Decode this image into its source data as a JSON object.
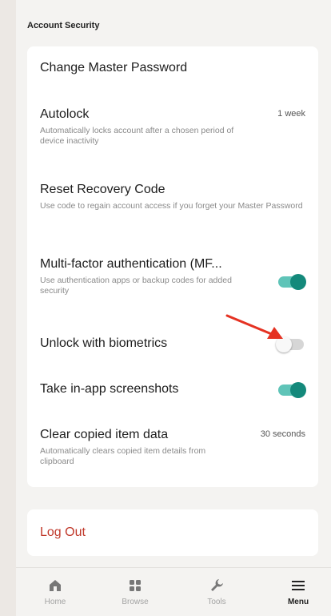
{
  "section_title": "Account Security",
  "settings": [
    {
      "title": "Change Master Password"
    },
    {
      "title": "Autolock",
      "value": "1 week",
      "subtitle": "Automatically locks account after a chosen period of device inactivity"
    },
    {
      "title": "Reset Recovery Code",
      "subtitle": "Use code to regain account access if you forget your Master Password"
    },
    {
      "title": "Multi-factor authentication (MF...",
      "subtitle": "Use authentication apps or backup codes for added security",
      "toggle_on": true
    },
    {
      "title": "Unlock with biometrics",
      "toggle_on": false
    },
    {
      "title": "Take in-app screenshots",
      "toggle_on": true
    },
    {
      "title": "Clear copied item data",
      "value": "30 seconds",
      "subtitle": "Automatically clears copied item details from clipboard"
    }
  ],
  "logout_label": "Log Out",
  "tabs": [
    {
      "label": "Home",
      "icon": "home-icon"
    },
    {
      "label": "Browse",
      "icon": "grid-icon"
    },
    {
      "label": "Tools",
      "icon": "wrench-icon"
    },
    {
      "label": "Menu",
      "icon": "menu-icon",
      "active": true
    }
  ],
  "colors": {
    "toggle_on": "#14897b",
    "logout": "#c0392b",
    "arrow": "#e53222"
  }
}
